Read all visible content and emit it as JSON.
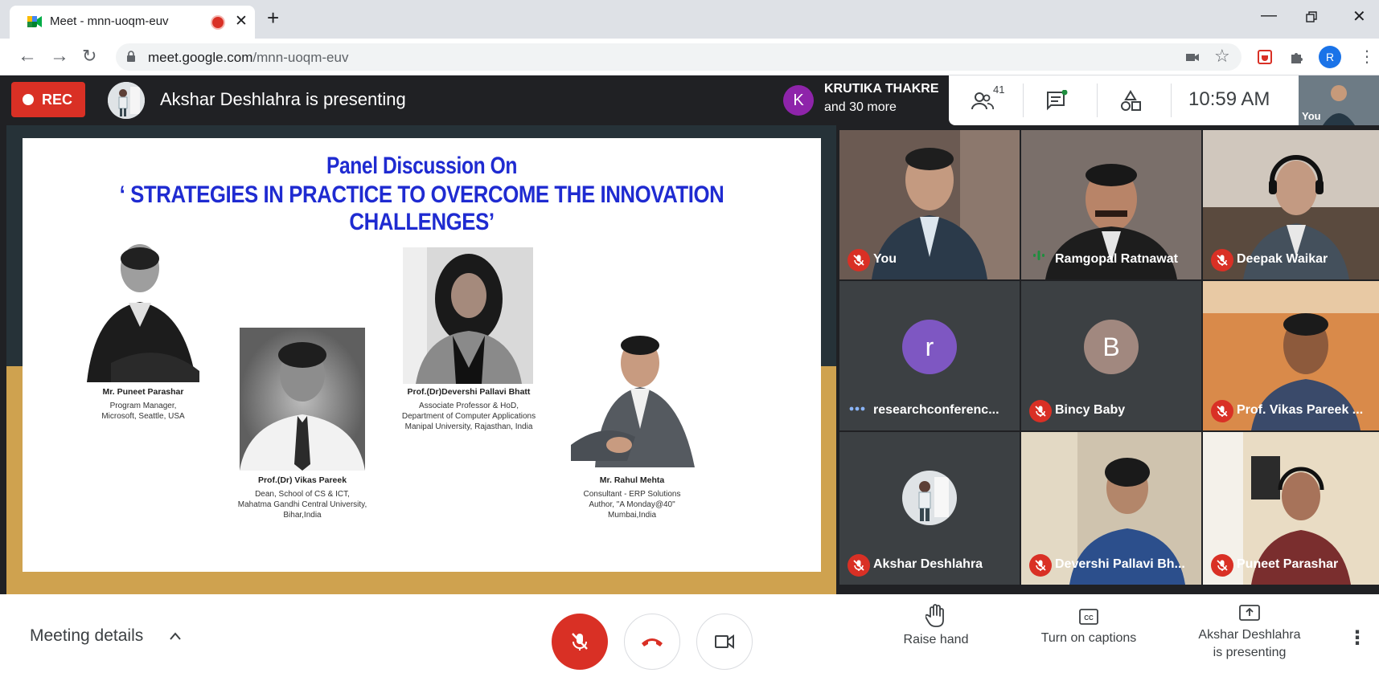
{
  "browser": {
    "tab_title": "Meet - mnn-uoqm-euv",
    "url_domain": "meet.google.com",
    "url_path": "/mnn-uoqm-euv",
    "profile_initial": "R"
  },
  "meet": {
    "rec_label": "REC",
    "presenting_text": "Akshar Deshlahra is presenting",
    "joined": {
      "avatar_initial": "K",
      "name": "KRUTIKA THAKRE",
      "more": "and 30 more",
      "avatar_color": "#8e24aa"
    },
    "participants_count": "41",
    "clock": "10:59 AM",
    "self_thumb_label": "You"
  },
  "slide": {
    "title_line1": "Panel Discussion On",
    "title_line2": "‘ STRATEGIES IN PRACTICE TO OVERCOME THE INNOVATION CHALLENGES’",
    "panelists": [
      {
        "name": "Mr. Puneet Parashar",
        "line1": "Program Manager,",
        "line2": "Microsoft, Seattle, USA",
        "line3": ""
      },
      {
        "name": "Prof.(Dr) Vikas Pareek",
        "line1": "Dean, School of CS & ICT,",
        "line2": "Mahatma Gandhi Central University,",
        "line3": "Bihar,India"
      },
      {
        "name": "Prof.(Dr)Devershi Pallavi Bhatt",
        "line1": "Associate Professor & HoD,",
        "line2": "Department of Computer Applications",
        "line3": "Manipal University, Rajasthan, India"
      },
      {
        "name": "Mr. Rahul Mehta",
        "line1": "Consultant - ERP Solutions",
        "line2": "Author, \"A Monday@40\"",
        "line3": "Mumbai,India"
      }
    ]
  },
  "tiles": [
    {
      "label": "You",
      "status": "muted"
    },
    {
      "label": "Ramgopal Ratnawat",
      "status": "speaking"
    },
    {
      "label": "Deepak Waikar",
      "status": "muted"
    },
    {
      "label": "researchconferenc...",
      "status": "more",
      "avatar_initial": "r",
      "avatar_color": "#7e57c2"
    },
    {
      "label": "Bincy Baby",
      "status": "muted",
      "avatar_initial": "B",
      "avatar_color": "#a1887f"
    },
    {
      "label": "Prof. Vikas Pareek ...",
      "status": "muted"
    },
    {
      "label": "Akshar Deshlahra",
      "status": "muted"
    },
    {
      "label": "Devershi Pallavi Bh...",
      "status": "muted"
    },
    {
      "label": "Puneet Parashar",
      "status": "muted"
    }
  ],
  "controls": {
    "meeting_details": "Meeting details",
    "raise_hand": "Raise hand",
    "captions": "Turn on captions",
    "presenting_line1": "Akshar Deshlahra",
    "presenting_line2": "is presenting"
  },
  "colors": {
    "accent_red": "#d93025",
    "meet_bg": "#202124",
    "slide_title_blue": "#1f2bd1"
  }
}
